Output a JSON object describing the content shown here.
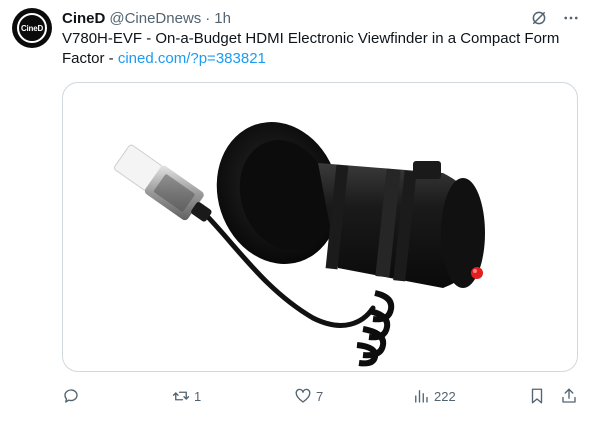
{
  "author": {
    "display_name": "CineD",
    "handle": "@CineDnews",
    "separator": "·",
    "time": "1h",
    "avatar_text": "CineD"
  },
  "tweet": {
    "text_prefix": "V780H-EVF - On-a-Budget HDMI Electronic Viewfinder in a Compact Form Factor - ",
    "link_text": "cined.com/?p=383821"
  },
  "media": {
    "description_icon": "product-photo"
  },
  "actions": {
    "reply": {
      "icon": "reply-icon",
      "count": ""
    },
    "retweet": {
      "icon": "retweet-icon",
      "count": "1"
    },
    "like": {
      "icon": "heart-icon",
      "count": "7"
    },
    "views": {
      "icon": "views-icon",
      "count": "222"
    },
    "bookmark": {
      "icon": "bookmark-icon"
    },
    "share": {
      "icon": "share-icon"
    }
  },
  "colors": {
    "link": "#1d9bf0",
    "muted": "#536471",
    "text": "#0f1419",
    "border": "#cfd9de"
  }
}
